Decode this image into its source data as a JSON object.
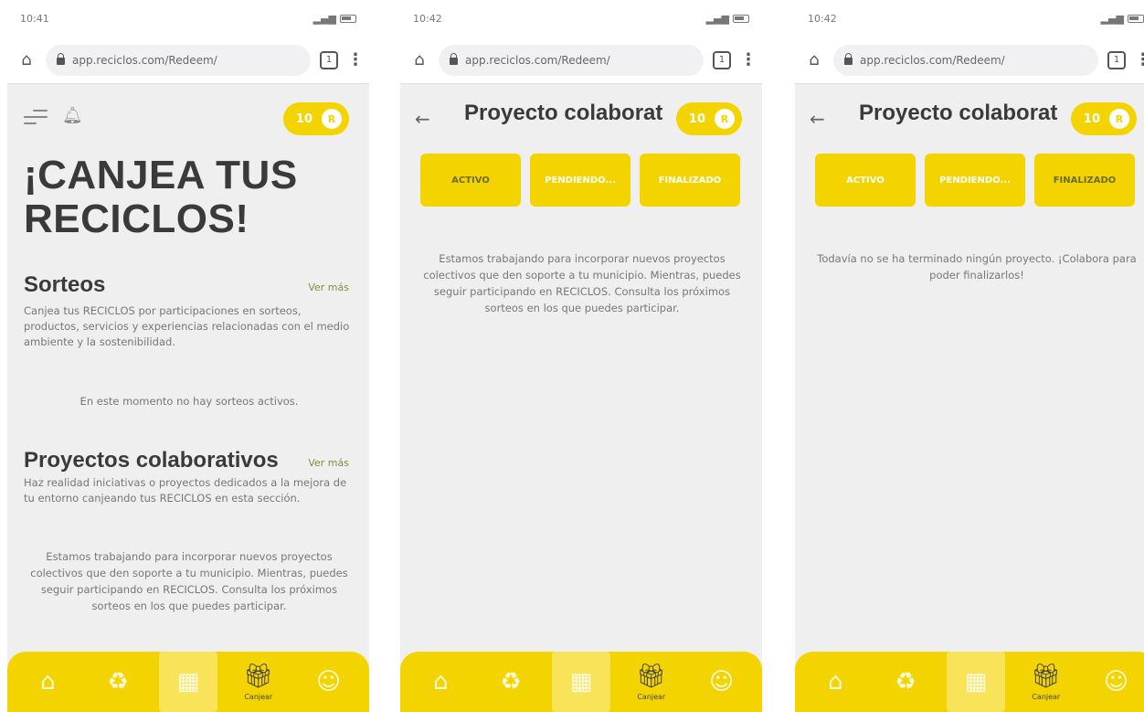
{
  "screens": [
    {
      "status": {
        "time": "10:41"
      },
      "browser": {
        "url": "app.reciclos.com/Redeem/",
        "tabs_count": "1"
      },
      "badge": {
        "value": "10"
      },
      "title": "¡CANJEA TUS RECICLOS!",
      "sorteos": {
        "title": "Sorteos",
        "ver_mas": "Ver más",
        "description": "Canjea tus RECICLOS por participaciones en sorteos, productos, servicios y experiencias relacionadas con el medio ambiente y la sostenibilidad.",
        "empty": "En este momento no hay sorteos activos."
      },
      "proyectos": {
        "title": "Proyectos colaborativos",
        "ver_mas": "Ver más",
        "description": "Haz realidad iniciativas o proyectos dedicados a la mejora de tu entorno canjeando tus RECICLOS en esta sección.",
        "empty": "Estamos trabajando para incorporar nuevos proyectos colectivos que den soporte a tu municipio. Mientras, puedes seguir participando en RECICLOS. Consulta los próximos sorteos en los que puedes participar."
      },
      "nav": {
        "gift_label": "Canjear"
      }
    },
    {
      "status": {
        "time": "10:42"
      },
      "browser": {
        "url": "app.reciclos.com/Redeem/",
        "tabs_count": "1"
      },
      "badge": {
        "value": "10"
      },
      "header_title": "Proyecto colaborat",
      "tabs": [
        "Activo",
        "Pendiendo...",
        "Finalizado"
      ],
      "message": "Estamos trabajando para incorporar nuevos proyectos colectivos que den soporte a tu municipio. Mientras, puedes seguir participando en RECICLOS. Consulta los próximos sorteos en los que puedes participar.",
      "nav": {
        "gift_label": "Canjear"
      }
    },
    {
      "status": {
        "time": "10:42"
      },
      "browser": {
        "url": "app.reciclos.com/Redeem/",
        "tabs_count": "1"
      },
      "badge": {
        "value": "10"
      },
      "header_title": "Proyecto colaborat",
      "tabs": [
        "Activo",
        "Pendiendo...",
        "Finalizado"
      ],
      "message": "Todavía no se ha terminado ningún proyecto. ¡Colabora para poder finalizarlos!",
      "nav": {
        "gift_label": "Canjear"
      }
    }
  ],
  "colors": {
    "accent": "#f4d400",
    "background": "#efefef",
    "heading": "#3a3a3a"
  }
}
